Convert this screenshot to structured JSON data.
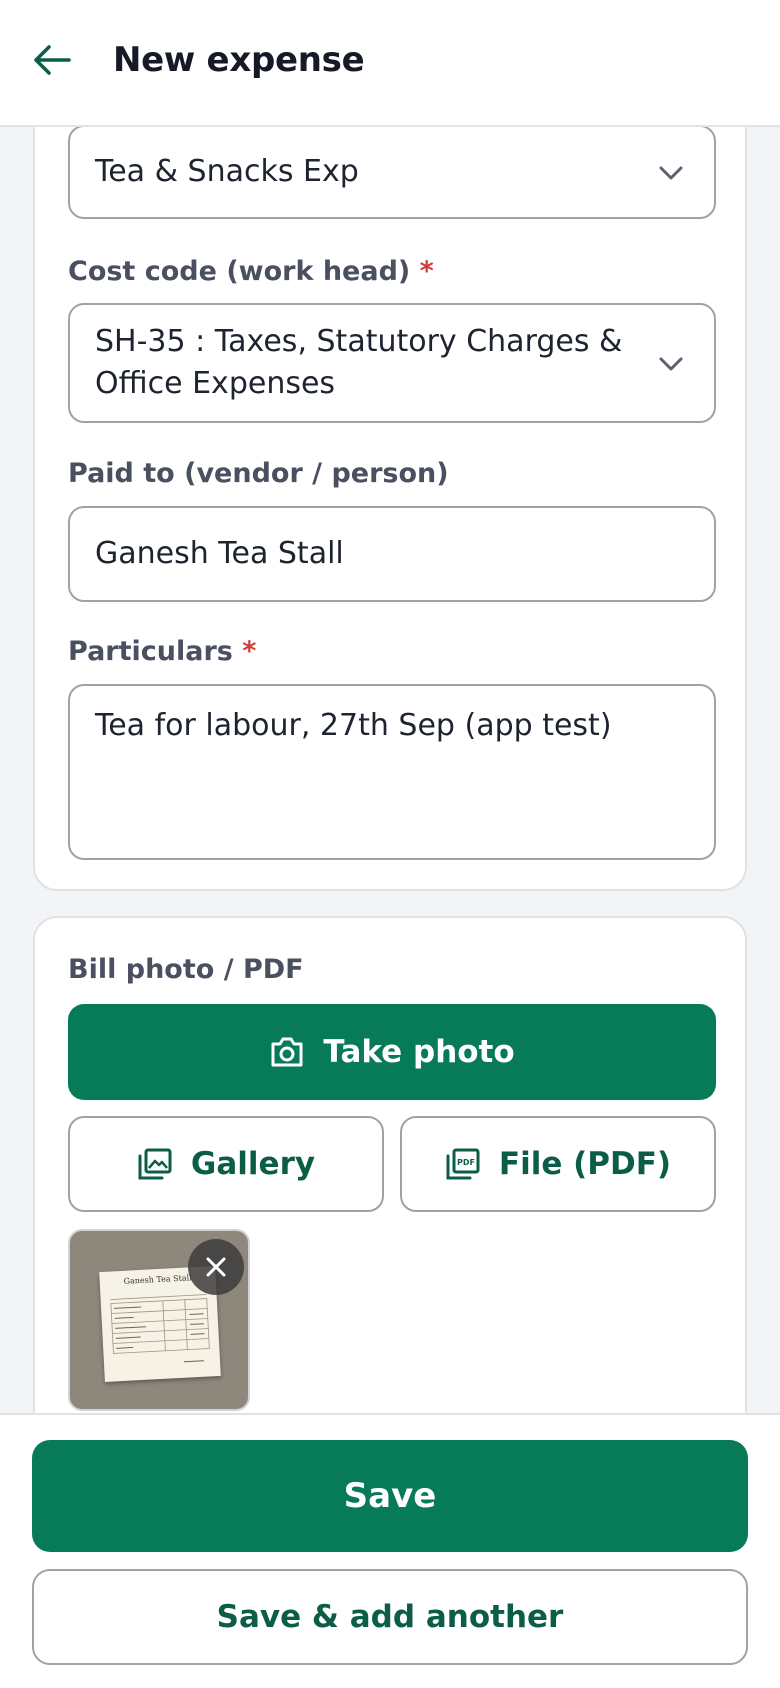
{
  "header": {
    "title": "New expense",
    "back_icon": "arrow-left-icon"
  },
  "form": {
    "category": {
      "value": "Tea & Snacks Exp"
    },
    "cost_code": {
      "label": "Cost code (work head)",
      "required_mark": "*",
      "value_line1": "SH-35 : Taxes, Statutory Charges &",
      "value_line2": "Office Expenses"
    },
    "paid_to": {
      "label": "Paid to (vendor / person)",
      "value": "Ganesh Tea Stall"
    },
    "particulars": {
      "label": "Particulars",
      "required_mark": "*",
      "value": "Tea for labour, 27th Sep (app test)"
    }
  },
  "attachments": {
    "label": "Bill photo / PDF",
    "take_photo_label": "Take photo",
    "gallery_label": "Gallery",
    "file_label": "File (PDF)",
    "thumbnail": {
      "title": "Ganesh Tea Stall"
    }
  },
  "footer": {
    "save_label": "Save",
    "save_add_label": "Save & add another"
  },
  "colors": {
    "primary": "#077a58",
    "primary_text": "#0c5d47",
    "required": "#d33a3a",
    "border": "#9ea3ab"
  }
}
